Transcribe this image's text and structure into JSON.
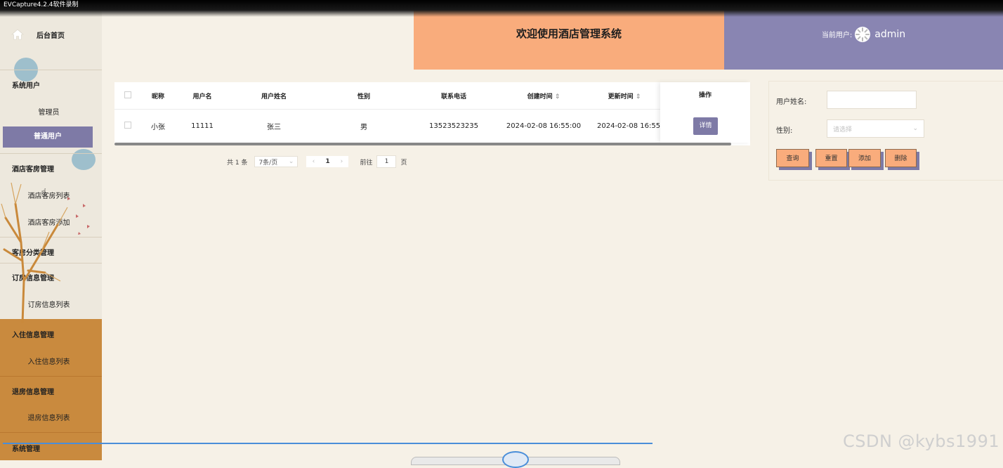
{
  "recorder": {
    "title": "EVCapture4.2.4软件录制"
  },
  "header": {
    "title": "欢迎使用酒店管理系统",
    "current_user_label": "当前用户:",
    "username": "admin"
  },
  "sidebar": {
    "home": "后台首页",
    "groups": [
      {
        "label": "系统用户",
        "children": [
          "管理员",
          "普通用户"
        ]
      },
      {
        "label": "酒店客房管理",
        "children": [
          "酒店客房列表",
          "酒店客房添加"
        ]
      },
      {
        "label": "客房分类管理",
        "children": []
      },
      {
        "label": "订房信息管理",
        "children": [
          "订房信息列表"
        ]
      },
      {
        "label": "入住信息管理",
        "children": [
          "入住信息列表"
        ]
      },
      {
        "label": "退房信息管理",
        "children": [
          "退房信息列表"
        ]
      },
      {
        "label": "系统管理",
        "children": []
      }
    ],
    "active_item": "普通用户"
  },
  "table": {
    "columns": [
      "昵称",
      "用户名",
      "用户姓名",
      "性别",
      "联系电话",
      "创建时间",
      "更新时间",
      "操作"
    ],
    "sort_icon": "⇕",
    "rows": [
      {
        "nickname": "小张",
        "username": "11111",
        "real_name": "张三",
        "gender": "男",
        "phone": "13523523235",
        "created": "2024-02-08 16:55:00",
        "updated": "2024-02-08 16:55:",
        "action": "详情"
      }
    ]
  },
  "pagination": {
    "total_text": "共 1 条",
    "page_size": "7条/页",
    "current_page": "1",
    "goto_label": "前往",
    "goto_value": "1",
    "goto_suffix": "页"
  },
  "search": {
    "name_label": "用户姓名:",
    "name_value": "",
    "gender_label": "性别:",
    "gender_placeholder": "请选择",
    "buttons": [
      "查询",
      "重置",
      "添加",
      "删除"
    ]
  },
  "watermark": "CSDN @kybs1991",
  "colors": {
    "accent_purple": "#7e7aa6",
    "accent_orange": "#f9ac7c",
    "header_purple": "#8985b2",
    "sidebar_lower": "#c98a3e",
    "background": "#f6f1e7"
  }
}
